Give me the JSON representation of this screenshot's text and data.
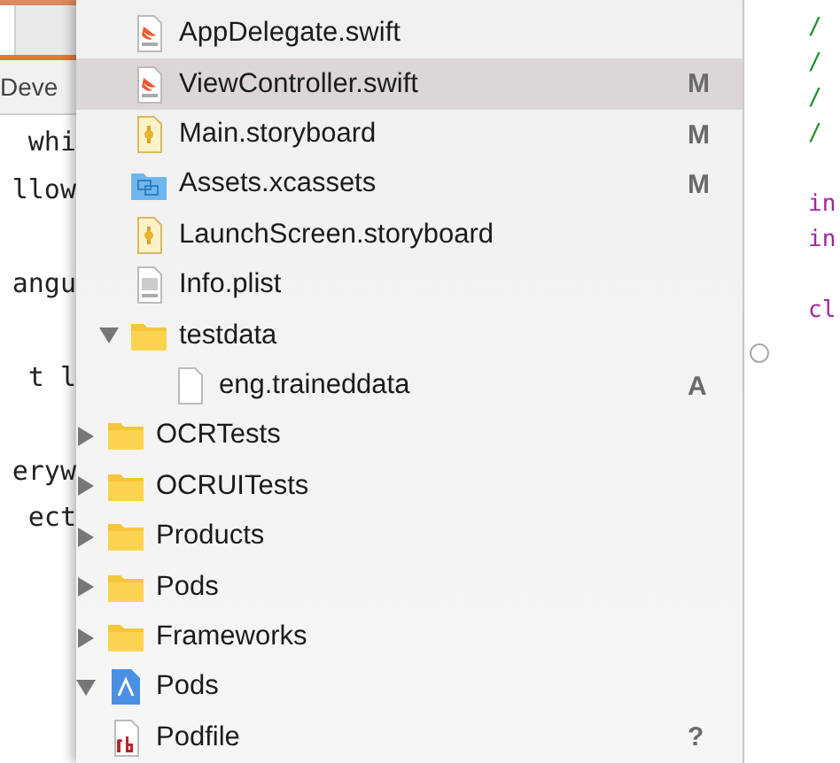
{
  "background_editor": {
    "tab_label": "Deve",
    "code_blocks": [
      [
        "whi",
        "llow"
      ],
      [
        "angu"
      ],
      [
        "t l"
      ],
      [
        "eryw",
        "ect"
      ]
    ]
  },
  "navigator": {
    "tree": [
      {
        "children": [
          {
            "children": [
              {
                "label": "AppDelegate.swift",
                "kind": "swift",
                "selected": false
              },
              {
                "label": "ViewController.swift",
                "kind": "swift",
                "status": "M",
                "selected": true
              },
              {
                "label": "Main.storyboard",
                "kind": "storyboard",
                "status": "M",
                "selected": false
              },
              {
                "label": "Assets.xcassets",
                "kind": "assets",
                "status": "M",
                "selected": false
              },
              {
                "label": "LaunchScreen.storyboard",
                "kind": "storyboard",
                "selected": false
              },
              {
                "label": "Info.plist",
                "kind": "plist",
                "selected": false
              },
              {
                "label": "testdata",
                "kind": "folder",
                "expanded": true,
                "selected": false,
                "children": [
                  {
                    "label": "eng.traineddata",
                    "kind": "file",
                    "status": "A",
                    "selected": false
                  }
                ]
              }
            ]
          },
          {
            "label": "OCRTests",
            "kind": "folder",
            "expanded": false,
            "selected": false
          },
          {
            "label": "OCRUITests",
            "kind": "folder",
            "expanded": false,
            "selected": false
          },
          {
            "label": "Products",
            "kind": "folder",
            "expanded": false,
            "selected": false
          },
          {
            "label": "Pods",
            "kind": "folder",
            "expanded": false,
            "selected": false
          },
          {
            "label": "Frameworks",
            "kind": "folder",
            "expanded": false,
            "selected": false
          }
        ]
      },
      {
        "label": "Pods",
        "kind": "project",
        "expanded": true,
        "selected": false,
        "children": [
          {
            "label": "Podfile",
            "kind": "ruby",
            "status": "?",
            "selected": false
          }
        ]
      }
    ]
  },
  "code_editor": {
    "blocks": [
      [
        {
          "text": "/",
          "kind": "comment"
        },
        {
          "text": "/",
          "kind": "comment"
        },
        {
          "text": "/",
          "kind": "comment"
        },
        {
          "text": "/",
          "kind": "comment"
        }
      ],
      [
        {
          "text": "in",
          "kind": "keyword"
        },
        {
          "text": "in",
          "kind": "keyword"
        }
      ],
      [
        {
          "text": "cl",
          "kind": "keyword"
        }
      ]
    ]
  }
}
